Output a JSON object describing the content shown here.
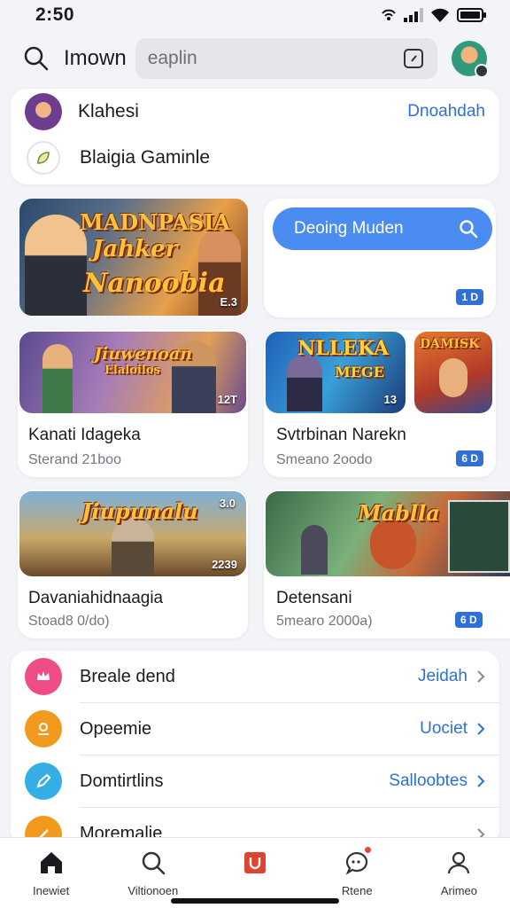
{
  "status": {
    "time": "2:50"
  },
  "header": {
    "title": "Imown",
    "search_placeholder": "еaplin"
  },
  "account": {
    "name": "Klahesi",
    "link": "Dnoahdah",
    "secondary": "Blaigia Gaminle"
  },
  "featured": {
    "art_title_1": "MADNPASIA",
    "art_title_2": "Jahker",
    "art_title_3": "Nanoobia",
    "art_tag": "E.3"
  },
  "promo": {
    "label": "Deoing Muden",
    "badge": "1 D"
  },
  "games": [
    {
      "art_title": "Jiuwenoan",
      "art_sub": "Elaloilos",
      "art_tag": "12T",
      "title": "Kanati Idageka",
      "sub": "Sterand 21boo"
    },
    {
      "art_title": "NLLEKA",
      "art_sub": "MEGE",
      "art_tag": "13",
      "art2_title": "DAMISK",
      "title": "Svtrbinan Narekn",
      "sub": "Smeano 2oodo",
      "badge": "6 D"
    },
    {
      "art_title": "Jiupunalu",
      "art_tag": "2239",
      "art_tag2": "3.0",
      "title": "Davaniahidnaagia",
      "sub": "Stoad8 0/do)"
    },
    {
      "art_title": "Mablla",
      "title": "Detensani",
      "sub": "5mearo 2000a)",
      "badge": "6 D"
    }
  ],
  "settings": [
    {
      "label": "Breale dend",
      "value": "Jeidah",
      "color": "#ef4d86"
    },
    {
      "label": "Opeemie",
      "value": "Uociet",
      "color": "#f29a1d"
    },
    {
      "label": "Domtirtlins",
      "value": "Salloobtes",
      "color": "#35aee6"
    },
    {
      "label": "Moremalie",
      "value": "",
      "color": "#f29a1d"
    }
  ],
  "nav": [
    {
      "label": "Inewiet"
    },
    {
      "label": "Viltionoen"
    },
    {
      "label": ""
    },
    {
      "label": "Rtene"
    },
    {
      "label": "Arimeo"
    }
  ],
  "colors": {
    "accent": "#2f6fd6",
    "promo": "#4a8cf0",
    "brand_red": "#e0432f"
  }
}
